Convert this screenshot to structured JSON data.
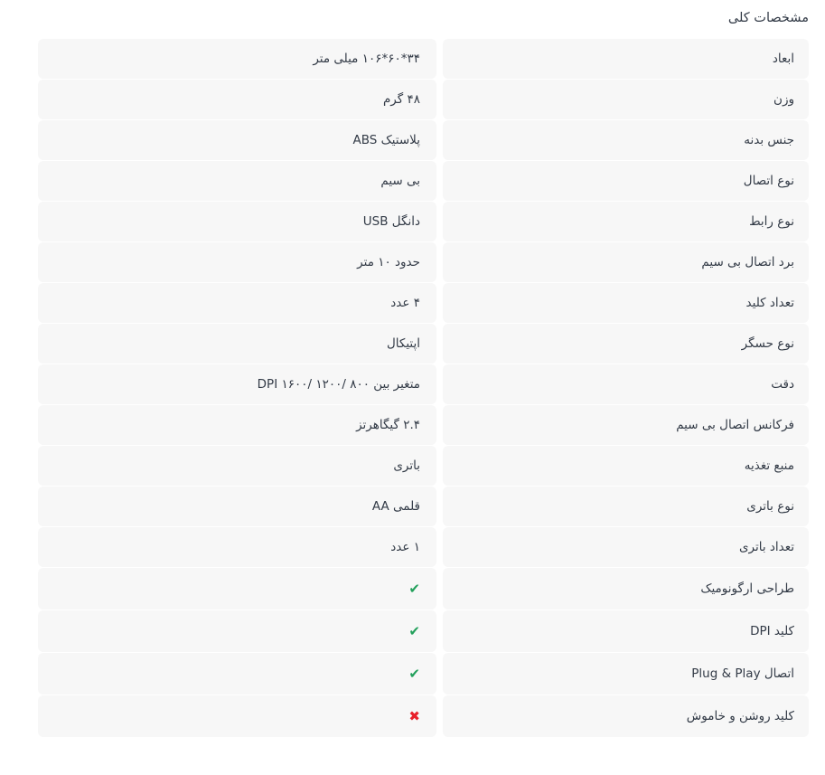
{
  "panel": {
    "title": "مشخصات کلی"
  },
  "icons": {
    "yes_glyph": "✔",
    "no_glyph": "✖",
    "yes_name": "check-icon",
    "no_name": "cross-icon",
    "yes_color": "#22a05b",
    "no_color": "#e8202a"
  },
  "colors": {
    "cell_background": "#f7f7f7",
    "page_background": "#ffffff",
    "text": "#333b47"
  },
  "specs": [
    {
      "label": "ابعاد",
      "value": "۳۴*۶۰*۱۰۶ میلی متر",
      "type": "text"
    },
    {
      "label": "وزن",
      "value": "۴۸ گرم",
      "type": "text"
    },
    {
      "label": "جنس بدنه",
      "value": "پلاستیک ABS",
      "type": "text"
    },
    {
      "label": "نوع اتصال",
      "value": "بی سیم",
      "type": "text"
    },
    {
      "label": "نوع رابط",
      "value": "دانگل USB",
      "type": "text"
    },
    {
      "label": "برد اتصال بی سیم",
      "value": "حدود ۱۰ متر",
      "type": "text"
    },
    {
      "label": "تعداد کلید",
      "value": "۴ عدد",
      "type": "text"
    },
    {
      "label": "نوع حسگر",
      "value": "اپتیکال",
      "type": "text"
    },
    {
      "label": "دقت",
      "value": "متغیر بین ۸۰۰ /۱۲۰۰ /۱۶۰۰ DPI",
      "type": "text"
    },
    {
      "label": "فرکانس اتصال بی سیم",
      "value": "۲.۴ گیگاهرتز",
      "type": "text"
    },
    {
      "label": "منبع تغذیه",
      "value": "باتری",
      "type": "text"
    },
    {
      "label": "نوع باتری",
      "value": "قلمی AA",
      "type": "text"
    },
    {
      "label": "تعداد باتری",
      "value": "۱ عدد",
      "type": "text"
    },
    {
      "label": "طراحی ارگونومیک",
      "value": "✔",
      "type": "yes"
    },
    {
      "label": "کلید DPI",
      "value": "✔",
      "type": "yes"
    },
    {
      "label": "اتصال Plug & Play",
      "value": "✔",
      "type": "yes"
    },
    {
      "label": "کلید روشن و خاموش",
      "value": "✖",
      "type": "no"
    }
  ]
}
